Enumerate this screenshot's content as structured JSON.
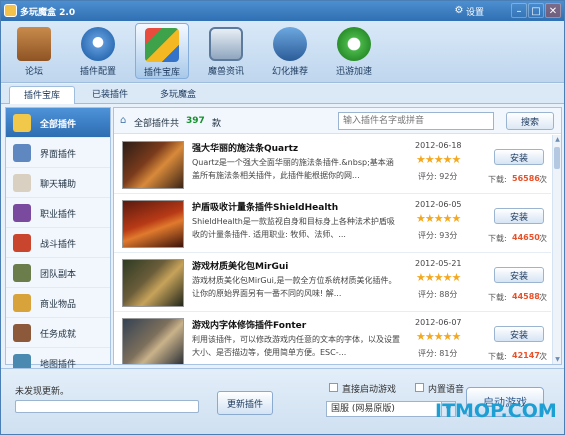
{
  "app": {
    "title": "多玩魔盒 2.0",
    "settings_label": "设置"
  },
  "toolbar": {
    "items": [
      {
        "label": "论坛"
      },
      {
        "label": "插件配置"
      },
      {
        "label": "插件宝库"
      },
      {
        "label": "魔兽资讯"
      },
      {
        "label": "幻化推荐"
      },
      {
        "label": "迅游加速"
      }
    ]
  },
  "tabs": [
    {
      "label": "插件宝库"
    },
    {
      "label": "已装插件"
    },
    {
      "label": "多玩魔盒"
    }
  ],
  "sidebar": {
    "items": [
      {
        "label": "全部插件"
      },
      {
        "label": "界面插件"
      },
      {
        "label": "聊天辅助"
      },
      {
        "label": "职业插件"
      },
      {
        "label": "战斗插件"
      },
      {
        "label": "团队副本"
      },
      {
        "label": "商业物品"
      },
      {
        "label": "任务成就"
      },
      {
        "label": "地图插件"
      }
    ]
  },
  "main": {
    "all_label": "全部插件共",
    "total": "397",
    "unit": "款",
    "search_placeholder": "输入插件名字或拼音",
    "search_button": "搜索"
  },
  "plugins": [
    {
      "name": "强大华丽的施法条Quartz",
      "desc": "Quartz是一个强大全面华丽的施法条插件.&nbsp;基本涵盖所有施法条相关插件，此插件能根据你的网...",
      "date": "2012-06-18",
      "stars": "★★★★★",
      "score": "评分: 92分",
      "install": "安装",
      "dl_label": "下载:",
      "downloads": "56586",
      "dl_unit": "次"
    },
    {
      "name": "护盾吸收计量条插件ShieldHealth",
      "desc": "ShieldHealth是一款监视自身和目标身上各种法术护盾吸收的计量条插件. 适用职业: 牧师、法师、...",
      "date": "2012-06-05",
      "stars": "★★★★★",
      "score": "评分: 93分",
      "install": "安装",
      "dl_label": "下载:",
      "downloads": "44650",
      "dl_unit": "次"
    },
    {
      "name": "游戏材质美化包MirGui",
      "desc": "游戏材质美化包MirGui,是一款全方位系统材质美化插件。让你的原始界面另有一番不同的风味! 解...",
      "date": "2012-05-21",
      "stars": "★★★★★",
      "score": "评分: 88分",
      "install": "安装",
      "dl_label": "下载:",
      "downloads": "44588",
      "dl_unit": "次"
    },
    {
      "name": "游戏内字体修饰插件Fonter",
      "desc": "利用该插件，可以修改游戏内任意的文本的字体，以及设置大小、是否描边等，使用简单方便。ESC-...",
      "date": "2012-06-07",
      "stars": "★★★★★",
      "score": "评分: 81分",
      "install": "安装",
      "dl_label": "下载:",
      "downloads": "42147",
      "dl_unit": "次"
    }
  ],
  "bottom": {
    "update_status": "未发现更新。",
    "progress": 0,
    "update_button": "更新插件",
    "direct_start_label": "直接启动游戏",
    "voice_label": "内置语音",
    "server": "国服 (网易原版)",
    "start_button": "启动游戏"
  },
  "watermark": "ITMOP.COM"
}
